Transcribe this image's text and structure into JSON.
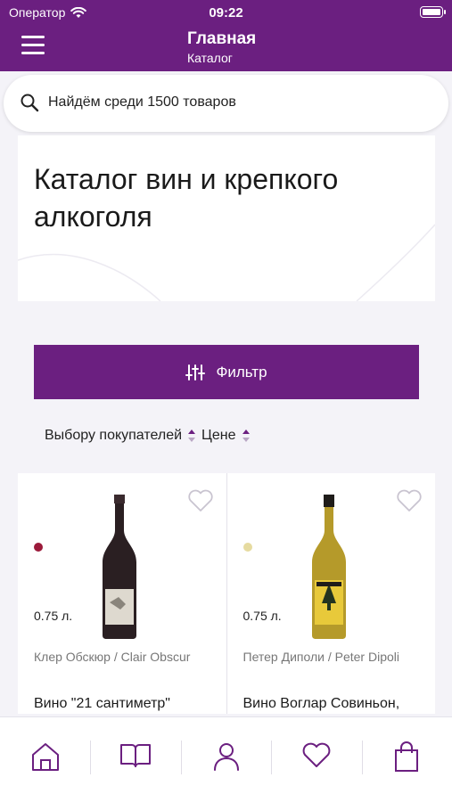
{
  "status_bar": {
    "carrier": "Оператор",
    "time": "09:22"
  },
  "header": {
    "title": "Главная",
    "subtitle": "Каталог"
  },
  "search": {
    "placeholder": "Найдём среди 1500 товаров"
  },
  "hero": {
    "title": "Каталог вин и крепкого алкоголя"
  },
  "filter": {
    "label": "Фильтр"
  },
  "sort": {
    "options": [
      "Выбору покупателей",
      "Цене"
    ]
  },
  "products": [
    {
      "dot_color": "#9b1a3a",
      "volume": "0.75 л.",
      "producer": "Клер Обскюр / Clair Obscur",
      "name": "Вино \"21 сантиметр\""
    },
    {
      "dot_color": "#e6dba0",
      "volume": "0.75 л.",
      "producer": "Петер Диполи / Peter Dipoli",
      "name": "Вино Воглар Совиньон,"
    }
  ],
  "tab_bar": {
    "items": [
      "home-icon",
      "book-icon",
      "user-icon",
      "heart-icon",
      "bag-icon"
    ]
  },
  "colors": {
    "brand": "#6b1f80"
  }
}
